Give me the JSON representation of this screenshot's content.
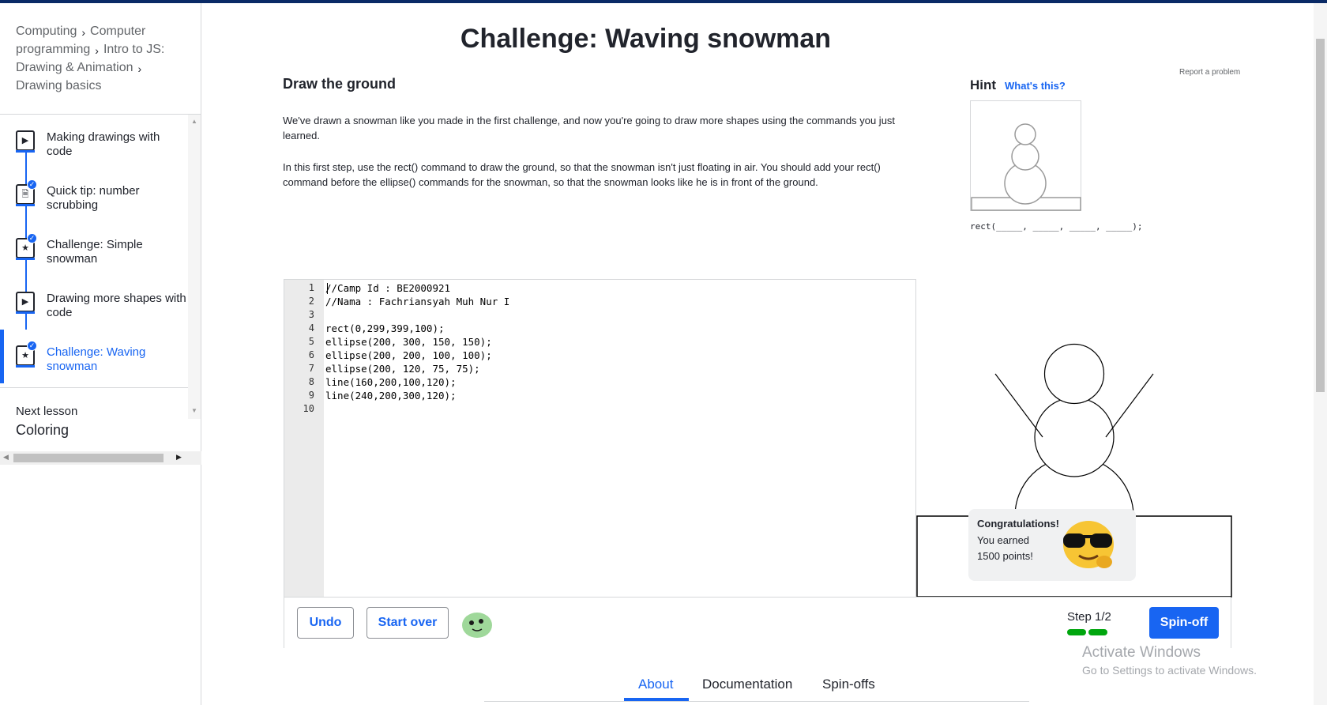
{
  "breadcrumb": {
    "items": [
      "Computing",
      "Computer programming",
      "Intro to JS: Drawing & Animation",
      "Drawing basics"
    ]
  },
  "sidebar": {
    "items": [
      {
        "label": "Making drawings with code",
        "icon": "play-icon",
        "completed": false,
        "active": false
      },
      {
        "label": "Quick tip: number scrubbing",
        "icon": "document-icon",
        "completed": true,
        "active": false
      },
      {
        "label": "Challenge: Simple snowman",
        "icon": "star-icon",
        "completed": true,
        "active": false
      },
      {
        "label": "Drawing more shapes with code",
        "icon": "play-icon",
        "completed": false,
        "active": false
      },
      {
        "label": "Challenge: Waving snowman",
        "icon": "star-icon",
        "completed": true,
        "active": true
      }
    ],
    "next_lesson_label": "Next lesson",
    "next_lesson_title": "Coloring"
  },
  "page": {
    "title": "Challenge: Waving snowman",
    "step_title": "Draw the ground",
    "report_link": "Report a problem",
    "paragraphs": [
      "We've drawn a snowman like you made in the first challenge, and now you're going to draw more shapes using the commands you just learned.",
      "In this first step, use the rect() command to draw the ground, so that the snowman isn't just floating in air. You should add your rect() command before the ellipse() commands for the snowman, so that the snowman looks like he is in front of the ground."
    ]
  },
  "hint": {
    "label": "Hint",
    "link": "What's this?",
    "code": "rect(_____, _____, _____, _____);"
  },
  "editor": {
    "line_numbers": [
      "1",
      "2",
      "3",
      "4",
      "5",
      "6",
      "7",
      "8",
      "9",
      "10"
    ],
    "lines": [
      "//Camp Id : BE2000921",
      "//Nama : Fachriansyah Muh Nur I",
      "",
      "rect(0,299,399,100);",
      "ellipse(200, 300, 150, 150);",
      "ellipse(200, 200, 100, 100);",
      "ellipse(200, 120, 75, 75);",
      "line(160,200,100,120);",
      "line(240,200,300,120);",
      ""
    ]
  },
  "congrats": {
    "title": "Congratulations!",
    "line1": "You earned",
    "line2": "1500 points!"
  },
  "toolbar": {
    "undo_label": "Undo",
    "start_over_label": "Start over",
    "step_label": "Step 1/2",
    "spinoff_label": "Spin-off",
    "step_progress": {
      "completed": 2,
      "total": 2
    }
  },
  "tabs": [
    {
      "label": "About",
      "active": true
    },
    {
      "label": "Documentation",
      "active": false
    },
    {
      "label": "Spin-offs",
      "active": false
    }
  ],
  "watermark": {
    "title": "Activate Windows",
    "subtitle": "Go to Settings to activate Windows."
  },
  "colors": {
    "accent": "#1865f2",
    "progress": "#00a60e",
    "header_bar": "#0a2a66"
  }
}
